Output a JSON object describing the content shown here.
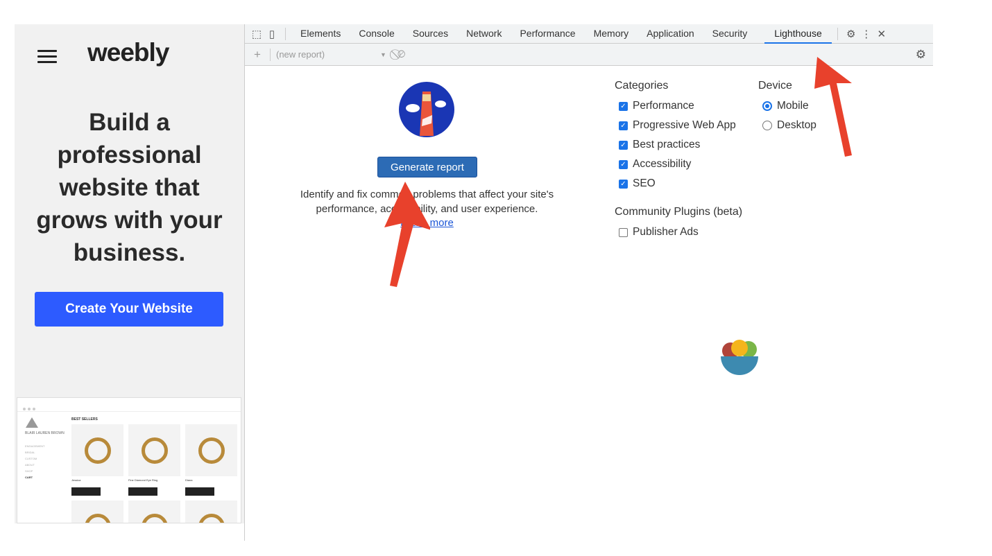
{
  "site": {
    "logo": "weebly",
    "headline": "Build a professional website that grows with your business.",
    "cta": "Create Your Website",
    "preview": {
      "brand": "BLAIR LAUREN BROWN",
      "nav": [
        "ENGAGEMENT",
        "BRIDAL",
        "CUSTOM",
        "ABOUT",
        "SHOP",
        "CART"
      ],
      "section": "BEST SELLERS",
      "products": [
        "Jessica",
        "Fine Diamond Eye Ring",
        "Diana"
      ]
    }
  },
  "devtools": {
    "tabs": [
      "Elements",
      "Console",
      "Sources",
      "Network",
      "Performance",
      "Memory",
      "Application",
      "Security",
      "Lighthouse"
    ],
    "active_tab": "Lighthouse",
    "report_select": "(new report)",
    "generate_label": "Generate report",
    "description": "Identify and fix common problems that affect your site's performance, accessibility, and user experience.",
    "learn_more": "Learn more",
    "categories_title": "Categories",
    "categories": [
      {
        "label": "Performance",
        "checked": true
      },
      {
        "label": "Progressive Web App",
        "checked": true
      },
      {
        "label": "Best practices",
        "checked": true
      },
      {
        "label": "Accessibility",
        "checked": true
      },
      {
        "label": "SEO",
        "checked": true
      }
    ],
    "plugins_title": "Community Plugins (beta)",
    "plugins": [
      {
        "label": "Publisher Ads",
        "checked": false
      }
    ],
    "device_title": "Device",
    "devices": [
      {
        "label": "Mobile",
        "selected": true
      },
      {
        "label": "Desktop",
        "selected": false
      }
    ]
  },
  "colors": {
    "accent": "#1a73e8",
    "cta": "#2d5bff",
    "arrow": "#e8412c"
  }
}
